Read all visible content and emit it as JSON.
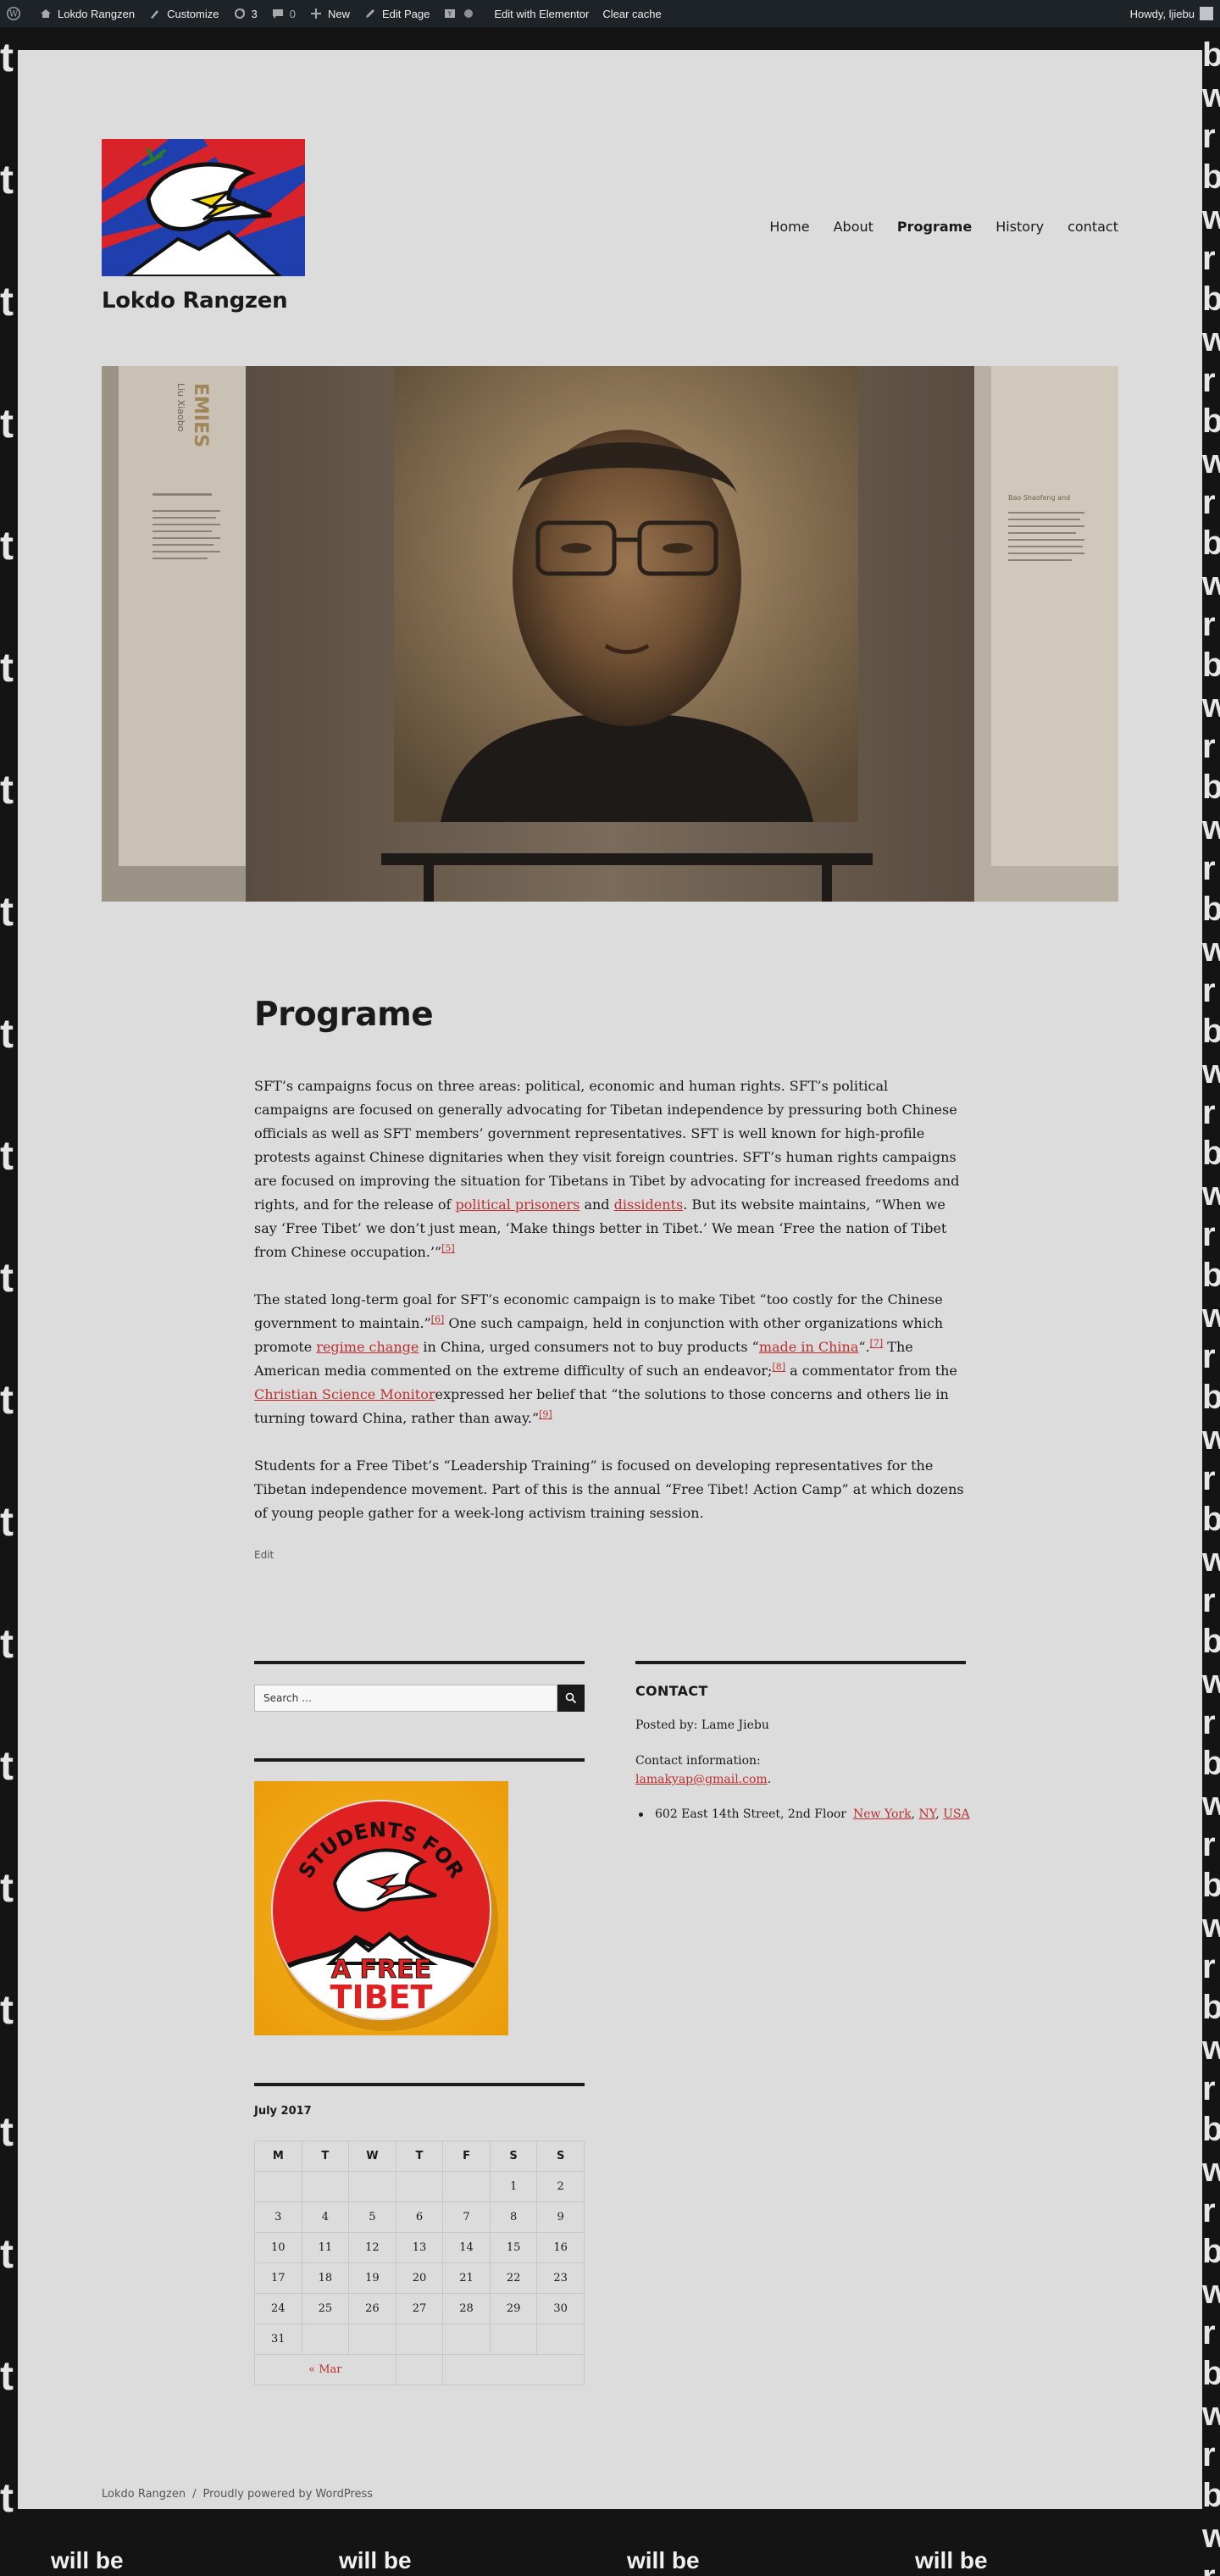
{
  "admin_bar": {
    "site_name": "Lokdo Rangzen",
    "customize": "Customize",
    "updates": "3",
    "comments": "0",
    "new": "New",
    "edit_page": "Edit Page",
    "edit_elementor": "Edit with Elementor",
    "clear_cache": "Clear cache",
    "howdy": "Howdy, ljiebu"
  },
  "background": {
    "letter": "t",
    "right_letters": [
      "b",
      "w",
      "r"
    ],
    "bottom_text": "will be"
  },
  "header": {
    "site_title": "Lokdo Rangzen",
    "nav": [
      {
        "label": "Home",
        "current": false
      },
      {
        "label": "About",
        "current": false
      },
      {
        "label": "Programe",
        "current": true
      },
      {
        "label": "History",
        "current": false
      },
      {
        "label": "contact",
        "current": false
      }
    ]
  },
  "hero": {
    "left_panel_text": "EMIES",
    "left_panel_subtext": "Liu Xiaobo",
    "right_panel_text": "Bao Shaofeng and"
  },
  "article": {
    "title": "Programe",
    "p1_a": "SFT’s campaigns focus on three areas: political, economic and human rights. SFT’s political campaigns are focused on generally advocating for Tibetan independence by pressuring both Chinese officials as well as SFT members’ government representatives. SFT is well known for high-profile protests against Chinese dignitaries when they visit foreign countries. SFT’s human rights campaigns are focused on improving the situation for Tibetans in Tibet by advocating for increased freedoms and rights, and for the release of ",
    "p1_link1": "political prisoners",
    "p1_b": " and ",
    "p1_link2": "dissidents",
    "p1_c": ". But its website maintains, “When we say ‘Free Tibet’ we don’t just mean, ‘Make things better in Tibet.’ We mean ‘Free the nation of Tibet from Chinese occupation.’”",
    "p1_ref": "[5]",
    "p2_a": "The stated long-term goal for SFT’s economic campaign is to make Tibet “too costly for the Chinese government to maintain.”",
    "p2_ref1": "[6]",
    "p2_b": " One such campaign, held in conjunction with other organizations which promote ",
    "p2_link1": "regime change",
    "p2_c": " in China, urged consumers not to buy products “",
    "p2_link2": "made in China",
    "p2_d": "“.",
    "p2_ref2": "[7]",
    "p2_e": " The American media commented on the extreme difficulty of such an endeavor;",
    "p2_ref3": "[8]",
    "p2_f": " a commentator from the ",
    "p2_link3": "Christian Science Monitor",
    "p2_g": "expressed her belief that “the solutions to those concerns and others lie in turning toward China, rather than away.”",
    "p2_ref4": "[9]",
    "p3": "Students for a Free Tibet’s “Leadership Training” is focused on developing representatives for the Tibetan independence movement. Part of this is the annual “Free Tibet! Action Camp” at which dozens of young people gather for a week-long activism training session.",
    "edit": "Edit"
  },
  "search": {
    "placeholder": "Search …"
  },
  "badge": {
    "top_text": "STUDENTS FOR",
    "middle_text": "A FREE",
    "bottom_text": "TIBET"
  },
  "calendar": {
    "caption": "July 2017",
    "headers": [
      "M",
      "T",
      "W",
      "T",
      "F",
      "S",
      "S"
    ],
    "weeks": [
      [
        "",
        "",
        "",
        "",
        "",
        "1",
        "2"
      ],
      [
        "3",
        "4",
        "5",
        "6",
        "7",
        "8",
        "9"
      ],
      [
        "10",
        "11",
        "12",
        "13",
        "14",
        "15",
        "16"
      ],
      [
        "17",
        "18",
        "19",
        "20",
        "21",
        "22",
        "23"
      ],
      [
        "24",
        "25",
        "26",
        "27",
        "28",
        "29",
        "30"
      ],
      [
        "31",
        "",
        "",
        "",
        "",
        "",
        ""
      ]
    ],
    "prev": "« Mar"
  },
  "contact": {
    "title": "CONTACT",
    "posted_by": "Posted by: Lame Jiebu",
    "info_label": "Contact information:",
    "email": "lamakyap@gmail.com",
    "email_suffix": ".",
    "address": "602 East 14th Street, 2nd Floor",
    "city": "New York",
    "state": "NY",
    "country": "USA"
  },
  "footer": {
    "site": "Lokdo Rangzen",
    "separator": "/",
    "powered": "Proudly powered by WordPress"
  },
  "colors": {
    "link": "#bd2f2f",
    "sheet": "#dcdcdc",
    "admin_bar": "#1d2327",
    "background": "#141414"
  }
}
